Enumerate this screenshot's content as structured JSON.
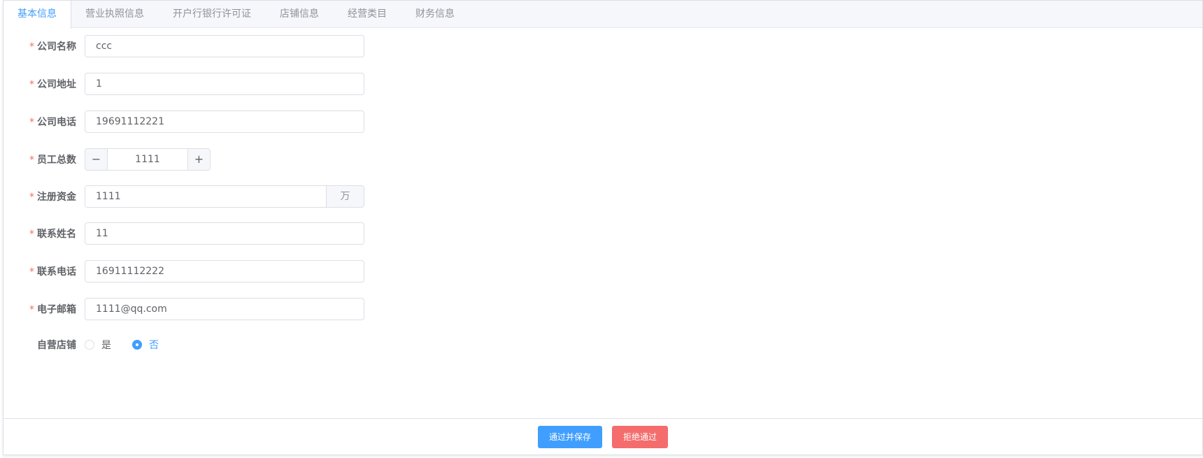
{
  "tabs": [
    {
      "label": "基本信息",
      "active": true
    },
    {
      "label": "营业执照信息",
      "active": false
    },
    {
      "label": "开户行银行许可证",
      "active": false
    },
    {
      "label": "店铺信息",
      "active": false
    },
    {
      "label": "经营类目",
      "active": false
    },
    {
      "label": "财务信息",
      "active": false
    }
  ],
  "form": {
    "required_mark": "*",
    "company_name": {
      "label": "公司名称",
      "value": "ccc"
    },
    "company_address": {
      "label": "公司地址",
      "value": "1"
    },
    "company_phone": {
      "label": "公司电话",
      "value": "19691112221"
    },
    "employee_count": {
      "label": "员工总数",
      "value": "1111",
      "minus": "−",
      "plus": "+"
    },
    "registered_capital": {
      "label": "注册资金",
      "value": "1111",
      "unit": "万"
    },
    "contact_name": {
      "label": "联系姓名",
      "value": "11"
    },
    "contact_phone": {
      "label": "联系电话",
      "value": "16911112222"
    },
    "email": {
      "label": "电子邮箱",
      "value": "1111@qq.com"
    },
    "self_operated": {
      "label": "自营店铺",
      "options": [
        {
          "label": "是",
          "checked": false
        },
        {
          "label": "否",
          "checked": true
        }
      ]
    }
  },
  "footer": {
    "approve_label": "通过并保存",
    "reject_label": "拒绝通过"
  },
  "colors": {
    "primary": "#409eff",
    "danger": "#f56c6c",
    "required": "#f56c6c"
  }
}
